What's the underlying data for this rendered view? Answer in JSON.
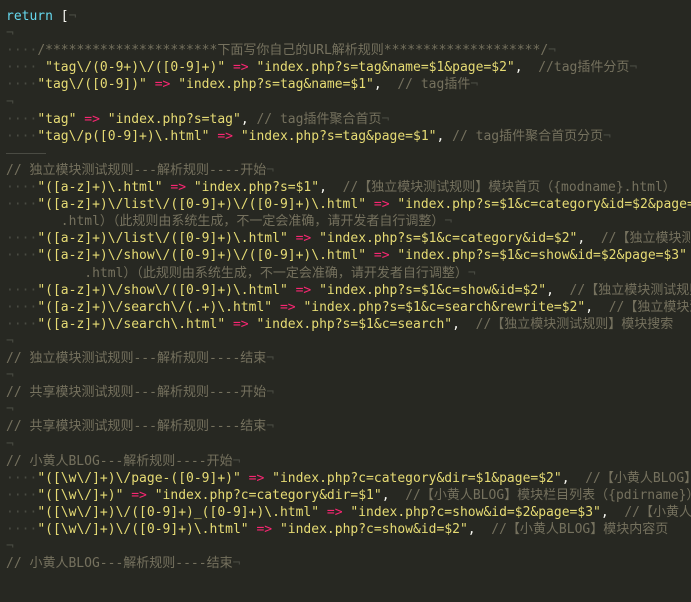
{
  "editor": {
    "colors": {
      "background": "#272822",
      "keyword": "#66d9ef",
      "string": "#e6db74",
      "operator": "#f92672",
      "comment": "#75715e",
      "whitespace": "#4a4b43"
    },
    "lines": [
      {
        "i": "",
        "parts": [
          {
            "c": "kw",
            "t": "return"
          },
          {
            "c": "punct",
            "t": " ["
          }
        ],
        "e": "¬"
      },
      {
        "i": "",
        "parts": [],
        "e": "¬"
      },
      {
        "i": "····",
        "parts": [
          {
            "c": "cmt",
            "t": "/**********************下面写你自己的URL解析规则********************/"
          }
        ],
        "e": "¬"
      },
      {
        "i": "····",
        "parts": [
          {
            "c": "str",
            "t": " \"tag\\/(0-9+)\\/([0-9]+)\""
          },
          {
            "c": "op",
            "t": " => "
          },
          {
            "c": "str",
            "t": "\"index.php?s=tag&name=$1&page=$2\""
          },
          {
            "c": "punct",
            "t": ",  "
          },
          {
            "c": "cmt",
            "t": "//tag插件分页"
          }
        ],
        "e": "¬"
      },
      {
        "i": "····",
        "parts": [
          {
            "c": "str",
            "t": "\"tag\\/([0-9])\""
          },
          {
            "c": "op",
            "t": " => "
          },
          {
            "c": "str",
            "t": "\"index.php?s=tag&name=$1\""
          },
          {
            "c": "punct",
            "t": ",  "
          },
          {
            "c": "cmt",
            "t": "// tag插件"
          }
        ],
        "e": "¬"
      },
      {
        "i": "",
        "parts": [],
        "e": "¬"
      },
      {
        "i": "····",
        "parts": [
          {
            "c": "str",
            "t": "\"tag\""
          },
          {
            "c": "op",
            "t": " => "
          },
          {
            "c": "str",
            "t": "\"index.php?s=tag\""
          },
          {
            "c": "punct",
            "t": ", "
          },
          {
            "c": "cmt",
            "t": "// tag插件聚合首页"
          }
        ],
        "e": "¬"
      },
      {
        "i": "····",
        "parts": [
          {
            "c": "str",
            "t": "\"tag\\/p([0-9]+)\\.html\""
          },
          {
            "c": "op",
            "t": " => "
          },
          {
            "c": "str",
            "t": "\"index.php?s=tag&page=$1\""
          },
          {
            "c": "punct",
            "t": ", "
          },
          {
            "c": "cmt",
            "t": "// tag插件聚合首页分页"
          }
        ],
        "e": "¬"
      },
      {
        "i": "",
        "parts": [],
        "e": ""
      },
      {
        "i": "",
        "parts": [
          {
            "c": "cmt",
            "t": "// 独立模块测试规则---解析规则----开始"
          }
        ],
        "e": "¬"
      },
      {
        "i": "····",
        "parts": [
          {
            "c": "str",
            "t": "\"([a-z]+)\\.html\""
          },
          {
            "c": "op",
            "t": " => "
          },
          {
            "c": "str",
            "t": "\"index.php?s=$1\""
          },
          {
            "c": "punct",
            "t": ",  "
          },
          {
            "c": "cmt",
            "t": "//【独立模块测试规则】模块首页（{modname}.html）"
          }
        ],
        "e": ""
      },
      {
        "i": "····",
        "parts": [
          {
            "c": "str",
            "t": "\"([a-z]+)\\/list\\/([0-9]+)\\/([0-9]+)\\.html\""
          },
          {
            "c": "op",
            "t": " => "
          },
          {
            "c": "str",
            "t": "\"index.php?s=$1&c=category&id=$2&page=$3\""
          }
        ],
        "e": ""
      },
      {
        "i": "",
        "parts": [
          {
            "c": "cmt",
            "t": "       .html）（此规则由系统生成，不一定会准确，请开发者自行调整）"
          }
        ],
        "e": "¬"
      },
      {
        "i": "····",
        "parts": [
          {
            "c": "str",
            "t": "\"([a-z]+)\\/list\\/([0-9]+)\\.html\""
          },
          {
            "c": "op",
            "t": " => "
          },
          {
            "c": "str",
            "t": "\"index.php?s=$1&c=category&id=$2\""
          },
          {
            "c": "punct",
            "t": ",  "
          },
          {
            "c": "cmt",
            "t": "//【独立模块测试规则】"
          }
        ],
        "e": ""
      },
      {
        "i": "····",
        "parts": [
          {
            "c": "str",
            "t": "\"([a-z]+)\\/show\\/([0-9]+)\\/([0-9]+)\\.html\""
          },
          {
            "c": "op",
            "t": " => "
          },
          {
            "c": "str",
            "t": "\"index.php?s=$1&c=show&id=$2&page=$3\""
          }
        ],
        "e": ""
      },
      {
        "i": "",
        "parts": [
          {
            "c": "cmt",
            "t": "          .html）（此规则由系统生成，不一定会准确，请开发者自行调整）"
          }
        ],
        "e": "¬"
      },
      {
        "i": "····",
        "parts": [
          {
            "c": "str",
            "t": "\"([a-z]+)\\/show\\/([0-9]+)\\.html\""
          },
          {
            "c": "op",
            "t": " => "
          },
          {
            "c": "str",
            "t": "\"index.php?s=$1&c=show&id=$2\""
          },
          {
            "c": "punct",
            "t": ",  "
          },
          {
            "c": "cmt",
            "t": "//【独立模块测试规则】"
          }
        ],
        "e": ""
      },
      {
        "i": "····",
        "parts": [
          {
            "c": "str",
            "t": "\"([a-z]+)\\/search\\/(.+)\\.html\""
          },
          {
            "c": "op",
            "t": " => "
          },
          {
            "c": "str",
            "t": "\"index.php?s=$1&c=search&rewrite=$2\""
          },
          {
            "c": "punct",
            "t": ",  "
          },
          {
            "c": "cmt",
            "t": "//【独立模块测试规则】"
          }
        ],
        "e": ""
      },
      {
        "i": "····",
        "parts": [
          {
            "c": "str",
            "t": "\"([a-z]+)\\/search\\.html\""
          },
          {
            "c": "op",
            "t": " => "
          },
          {
            "c": "str",
            "t": "\"index.php?s=$1&c=search\""
          },
          {
            "c": "punct",
            "t": ",  "
          },
          {
            "c": "cmt",
            "t": "//【独立模块测试规则】模块搜索"
          }
        ],
        "e": ""
      },
      {
        "i": "",
        "parts": [],
        "e": "¬"
      },
      {
        "i": "",
        "parts": [
          {
            "c": "cmt",
            "t": "// 独立模块测试规则---解析规则----结束"
          }
        ],
        "e": "¬"
      },
      {
        "i": "",
        "parts": [],
        "e": "¬"
      },
      {
        "i": "",
        "parts": [
          {
            "c": "cmt",
            "t": "// 共享模块测试规则---解析规则----开始"
          }
        ],
        "e": "¬"
      },
      {
        "i": "",
        "parts": [],
        "e": "¬"
      },
      {
        "i": "",
        "parts": [
          {
            "c": "cmt",
            "t": "// 共享模块测试规则---解析规则----结束"
          }
        ],
        "e": "¬"
      },
      {
        "i": "",
        "parts": [],
        "e": "¬"
      },
      {
        "i": "",
        "parts": [
          {
            "c": "cmt",
            "t": "// 小黄人BLOG---解析规则----开始"
          }
        ],
        "e": "¬"
      },
      {
        "i": "····",
        "parts": [
          {
            "c": "str",
            "t": "\"([\\w\\/]+)\\/page-([0-9]+)\""
          },
          {
            "c": "op",
            "t": " => "
          },
          {
            "c": "str",
            "t": "\"index.php?c=category&dir=$1&page=$2\""
          },
          {
            "c": "punct",
            "t": ",  "
          },
          {
            "c": "cmt",
            "t": "//【小黄人BLOG】模块"
          }
        ],
        "e": ""
      },
      {
        "i": "····",
        "parts": [
          {
            "c": "str",
            "t": "\"([\\w\\/]+)\""
          },
          {
            "c": "op",
            "t": " => "
          },
          {
            "c": "str",
            "t": "\"index.php?c=category&dir=$1\""
          },
          {
            "c": "punct",
            "t": ",  "
          },
          {
            "c": "cmt",
            "t": "//【小黄人BLOG】模块栏目列表（{pdirname}）"
          }
        ],
        "e": ""
      },
      {
        "i": "····",
        "parts": [
          {
            "c": "str",
            "t": "\"([\\w\\/]+)\\/([0-9]+)_([0-9]+)\\.html\""
          },
          {
            "c": "op",
            "t": " => "
          },
          {
            "c": "str",
            "t": "\"index.php?c=show&id=$2&page=$3\""
          },
          {
            "c": "punct",
            "t": ",  "
          },
          {
            "c": "cmt",
            "t": "//【小黄人BLOG】"
          }
        ],
        "e": ""
      },
      {
        "i": "····",
        "parts": [
          {
            "c": "str",
            "t": "\"([\\w\\/]+)\\/([0-9]+)\\.html\""
          },
          {
            "c": "op",
            "t": " => "
          },
          {
            "c": "str",
            "t": "\"index.php?c=show&id=$2\""
          },
          {
            "c": "punct",
            "t": ",  "
          },
          {
            "c": "cmt",
            "t": "//【小黄人BLOG】模块内容页"
          }
        ],
        "e": ""
      },
      {
        "i": "",
        "parts": [],
        "e": "¬"
      },
      {
        "i": "",
        "parts": [
          {
            "c": "cmt",
            "t": "// 小黄人BLOG---解析规则----结束"
          }
        ],
        "e": "¬"
      }
    ]
  }
}
